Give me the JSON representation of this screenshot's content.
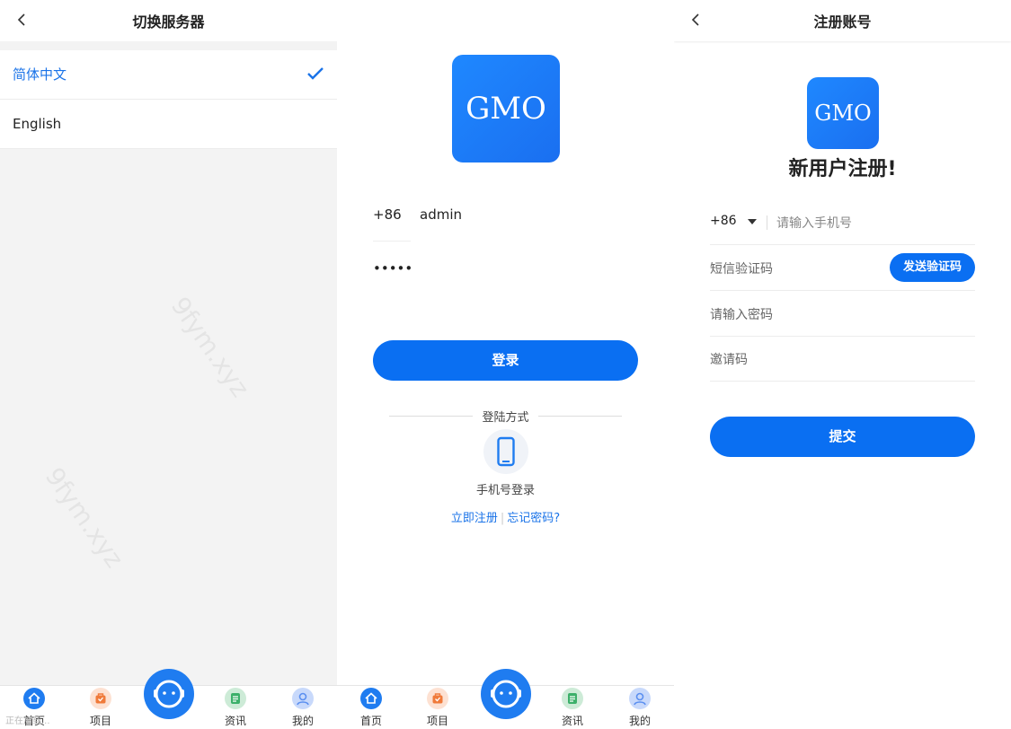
{
  "server_panel": {
    "title": "切换服务器",
    "languages": [
      {
        "label": "简体中文",
        "selected": true
      },
      {
        "label": "English",
        "selected": false
      }
    ],
    "toast": "正在加载..."
  },
  "login_panel": {
    "logo_text": "GMO",
    "country_code": "+86",
    "username": "admin",
    "password_mask": "•••••",
    "login_button": "登录",
    "login_methods_label": "登陆方式",
    "phone_login_label": "手机号登录",
    "register_link": "立即注册",
    "forgot_link": "忘记密码?"
  },
  "register_panel": {
    "title": "注册账号",
    "logo_text": "GMO",
    "heading": "新用户注册!",
    "country_code": "+86",
    "phone_placeholder": "请输入手机号",
    "sms_placeholder": "短信验证码",
    "send_code_button": "发送验证码",
    "password_placeholder": "请输入密码",
    "invite_placeholder": "邀请码",
    "submit_button": "提交"
  },
  "tabbar": {
    "tabs": [
      {
        "label": "首页",
        "icon": "home-icon",
        "color": "#1f7cf0"
      },
      {
        "label": "项目",
        "icon": "bag-icon",
        "color": "#f07a3a"
      },
      {
        "label": "资讯",
        "icon": "news-icon",
        "color": "#3cb06a"
      },
      {
        "label": "我的",
        "icon": "user-icon",
        "color": "#5b8ff0"
      }
    ],
    "service_icon": "customer-service-icon"
  },
  "watermark": "9fym.xyz",
  "colors": {
    "accent": "#0a6ff2",
    "link": "#1a73e8",
    "background_gray": "#f3f3f3"
  }
}
